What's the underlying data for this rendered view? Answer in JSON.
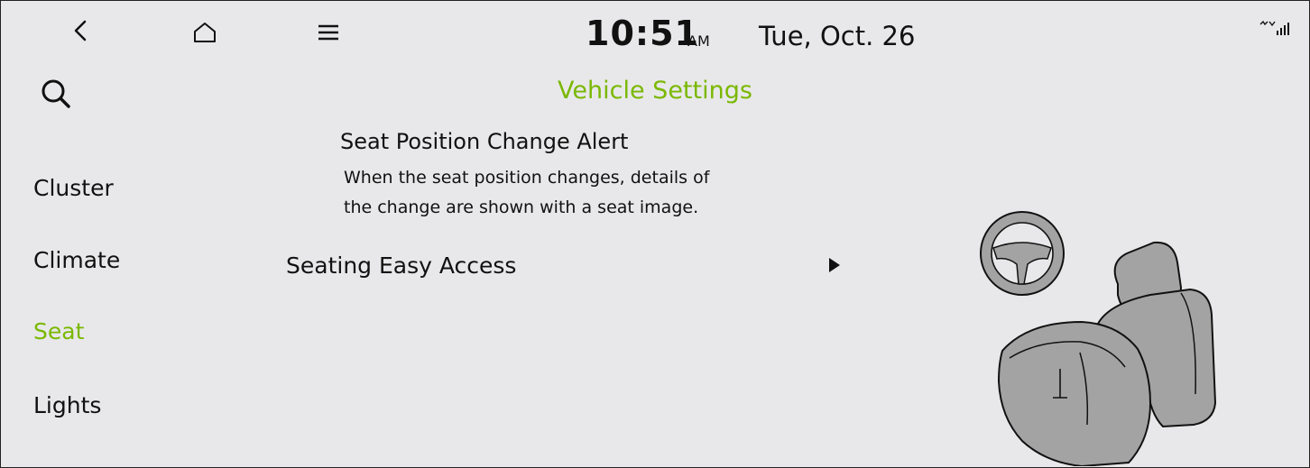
{
  "header": {
    "time": "10:51",
    "ampm": "AM",
    "date": "Tue, Oct. 26",
    "icons": [
      "back-icon",
      "home-icon",
      "menu-icon",
      "signal-icon"
    ]
  },
  "page_title": "Vehicle Settings",
  "search": {
    "icon": "search-icon"
  },
  "sidebar": {
    "items": [
      {
        "label": "Cluster",
        "active": false
      },
      {
        "label": "Climate",
        "active": false
      },
      {
        "label": "Seat",
        "active": true
      },
      {
        "label": "Lights",
        "active": false
      }
    ]
  },
  "setting": {
    "title": "Seat Position Change Alert",
    "description_line1": "When the seat position changes, details of",
    "description_line2": "the change are shown with a seat image."
  },
  "menu": {
    "seating_easy_access": "Seating Easy Access"
  },
  "colors": {
    "accent": "#7ab800",
    "background": "#e8e8ea",
    "seat_fill": "#a3a3a3"
  }
}
